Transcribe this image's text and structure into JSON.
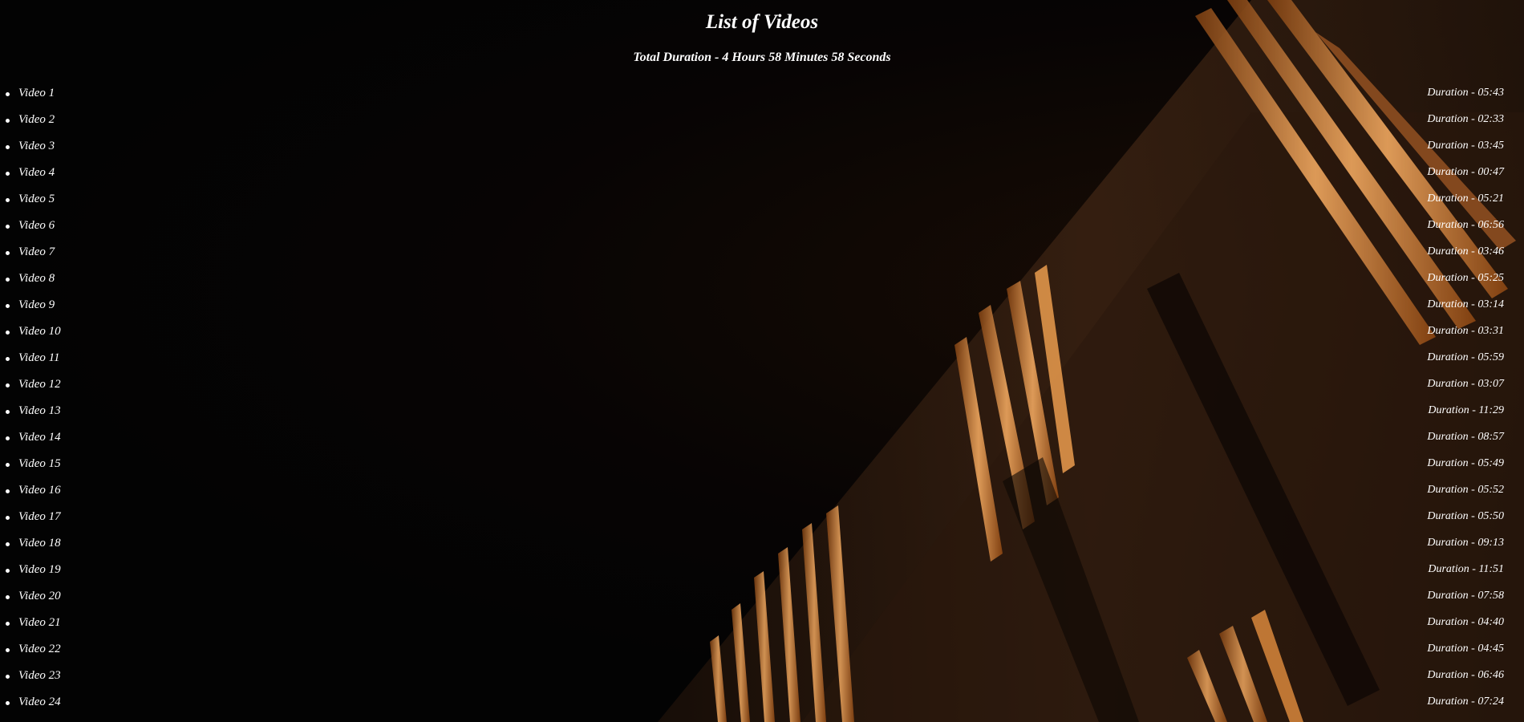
{
  "page": {
    "title": "List of Videos",
    "total_duration": "Total Duration - 4 Hours 58 Minutes 58 Seconds"
  },
  "videos": [
    {
      "title": "Video 1",
      "duration": "Duration - 05:43"
    },
    {
      "title": "Video 2",
      "duration": "Duration - 02:33"
    },
    {
      "title": "Video 3",
      "duration": "Duration - 03:45"
    },
    {
      "title": "Video 4",
      "duration": "Duration - 00:47"
    },
    {
      "title": "Video 5",
      "duration": "Duration - 05:21"
    },
    {
      "title": "Video 6",
      "duration": "Duration - 06:56"
    },
    {
      "title": "Video 7",
      "duration": "Duration - 03:46"
    },
    {
      "title": "Video 8",
      "duration": "Duration - 05:25"
    },
    {
      "title": "Video 9",
      "duration": "Duration - 03:14"
    },
    {
      "title": "Video 10",
      "duration": "Duration - 03:31"
    },
    {
      "title": "Video 11",
      "duration": "Duration - 05:59"
    },
    {
      "title": "Video 12",
      "duration": "Duration - 03:07"
    },
    {
      "title": "Video 13",
      "duration": "Duration - 11:29"
    },
    {
      "title": "Video 14",
      "duration": "Duration - 08:57"
    },
    {
      "title": "Video 15",
      "duration": "Duration - 05:49"
    },
    {
      "title": "Video 16",
      "duration": "Duration - 05:52"
    },
    {
      "title": "Video 17",
      "duration": "Duration - 05:50"
    },
    {
      "title": "Video 18",
      "duration": "Duration - 09:13"
    },
    {
      "title": "Video 19",
      "duration": "Duration - 11:51"
    },
    {
      "title": "Video 20",
      "duration": "Duration - 07:58"
    },
    {
      "title": "Video 21",
      "duration": "Duration - 04:40"
    },
    {
      "title": "Video 22",
      "duration": "Duration - 04:45"
    },
    {
      "title": "Video 23",
      "duration": "Duration - 06:46"
    },
    {
      "title": "Video 24",
      "duration": "Duration - 07:24"
    }
  ],
  "colors": {
    "text": "#ffffff",
    "background": "#050505",
    "light_accent": "#c8782e"
  }
}
